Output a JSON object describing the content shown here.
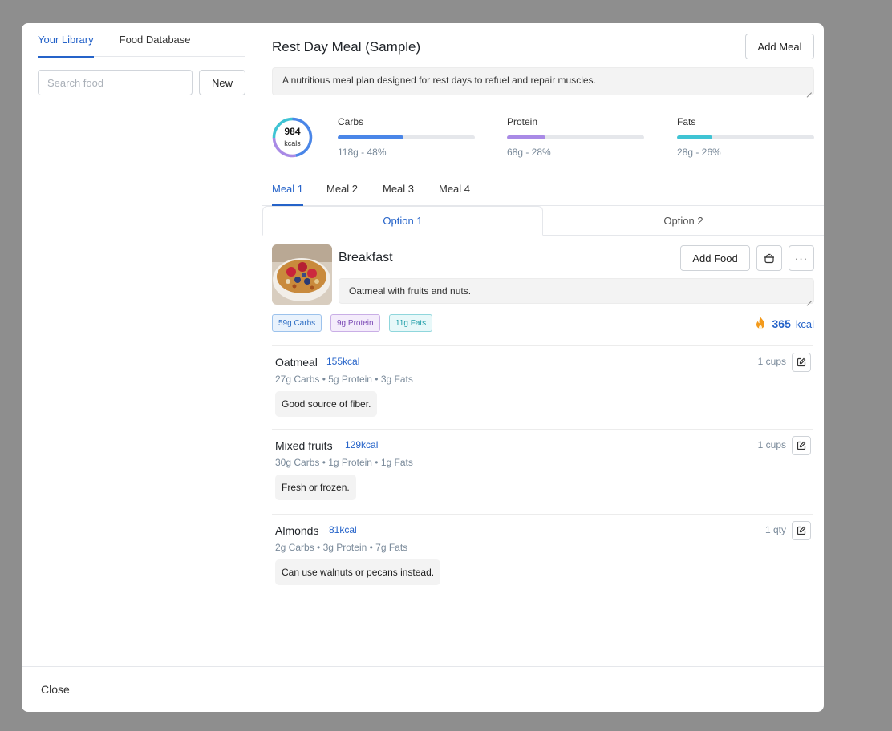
{
  "library": {
    "tabs": [
      {
        "label": "Your Library",
        "active": true
      },
      {
        "label": "Food Database",
        "active": false
      }
    ],
    "search_placeholder": "Search food",
    "new_label": "New"
  },
  "plan": {
    "title": "Rest Day Meal (Sample)",
    "add_meal_label": "Add Meal",
    "description": "A nutritious meal plan designed for rest days to refuel and repair muscles.",
    "kcals": "984",
    "kcals_unit": "kcals",
    "macros": [
      {
        "name": "Carbs",
        "value": "118g - 48%",
        "percent": 48,
        "color": "#4a86e8"
      },
      {
        "name": "Protein",
        "value": "68g - 28%",
        "percent": 28,
        "color": "#a98ae6"
      },
      {
        "name": "Fats",
        "value": "28g - 26%",
        "percent": 26,
        "color": "#3fc4d4"
      }
    ]
  },
  "meal_tabs": [
    "Meal 1",
    "Meal 2",
    "Meal 3",
    "Meal 4"
  ],
  "options": [
    "Option 1",
    "Option 2"
  ],
  "meal": {
    "name": "Breakfast",
    "add_food_label": "Add Food",
    "description": "Oatmeal with fruits and nuts.",
    "chips": {
      "carbs": "59g Carbs",
      "protein": "9g Protein",
      "fats": "11g Fats"
    },
    "kcal_total": "365",
    "kcal_unit": "kcal"
  },
  "foods": [
    {
      "name": "Oatmeal",
      "kcal": "155kcal",
      "carbs": "27g Carbs",
      "protein": "5g Protein",
      "fats": "3g Fats",
      "qty": "1 cups",
      "note": "Good source of fiber."
    },
    {
      "name": "Mixed fruits",
      "kcal": "129kcal",
      "carbs": "30g Carbs",
      "protein": "1g Protein",
      "fats": "1g Fats",
      "qty": "1 cups",
      "note": "Fresh or frozen."
    },
    {
      "name": "Almonds",
      "kcal": "81kcal",
      "carbs": "2g Carbs",
      "protein": "3g Protein",
      "fats": "7g Fats",
      "qty": "1 qty",
      "note": "Can use walnuts or pecans instead."
    }
  ],
  "footer": {
    "close_label": "Close"
  },
  "colors": {
    "accent": "#2563c9",
    "carbs": "#4a86e8",
    "protein": "#a98ae6",
    "fats": "#3fc4d4",
    "flame": "#f39a1b"
  }
}
